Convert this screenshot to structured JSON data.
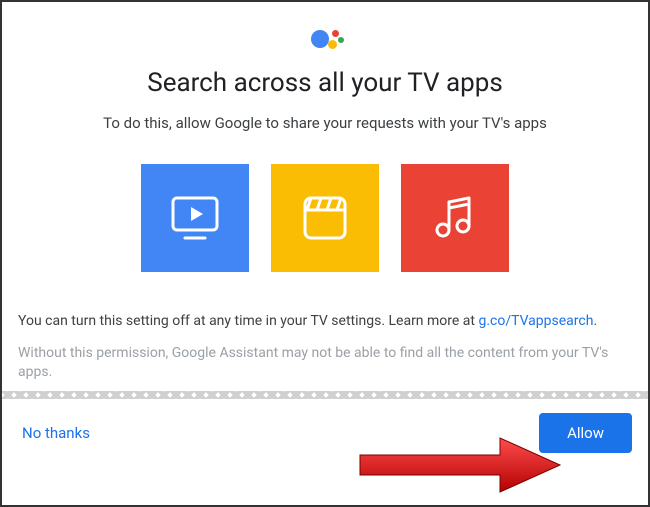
{
  "title": "Search across all your TV apps",
  "subtitle": "To do this, allow Google to share your requests with your TV's apps",
  "info_prefix": "You can turn this setting off at any time in your TV settings. Learn more at ",
  "info_link_text": "g.co/TVappsearch",
  "info_suffix": ".",
  "disclaimer": "Without this permission, Google Assistant may not be able to find all the content from your TV's apps.",
  "buttons": {
    "no_thanks": "No thanks",
    "allow": "Allow"
  },
  "colors": {
    "blue": "#4285f4",
    "yellow": "#fbbc04",
    "red": "#ea4335",
    "link": "#1a73e8"
  },
  "tiles": [
    {
      "name": "tv-play-tile",
      "icon": "tv-play-icon"
    },
    {
      "name": "movies-tile",
      "icon": "clapperboard-icon"
    },
    {
      "name": "music-tile",
      "icon": "music-note-icon"
    }
  ]
}
